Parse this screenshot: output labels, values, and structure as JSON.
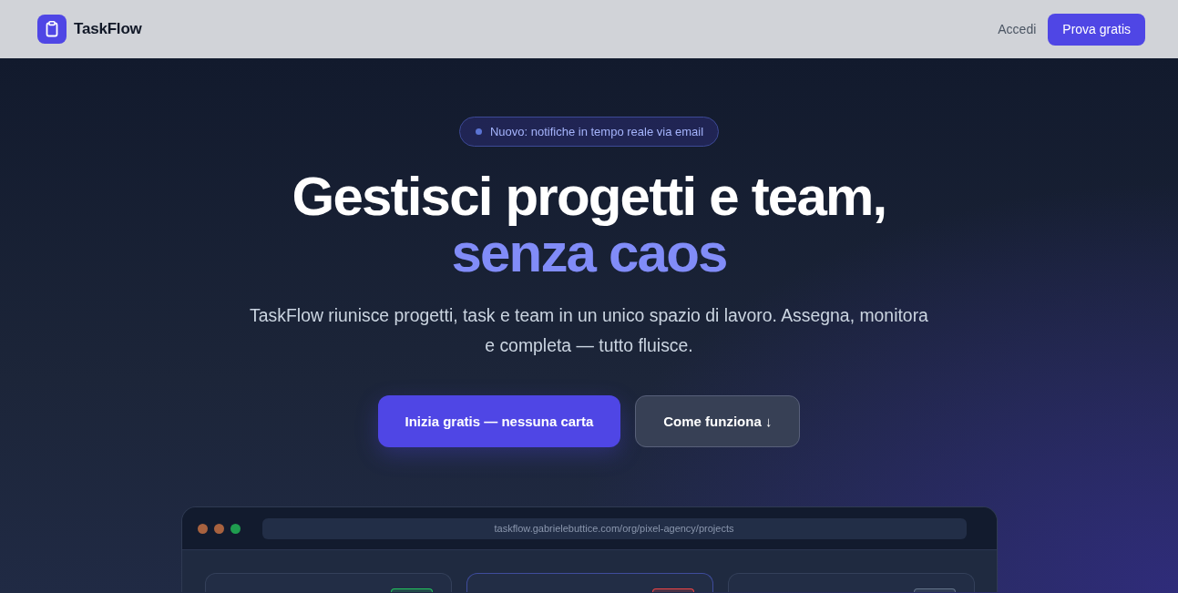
{
  "header": {
    "brand": "TaskFlow",
    "links": [
      {
        "label": "Accedi",
        "kind": "link"
      },
      {
        "label": "Prova gratis",
        "kind": "button"
      }
    ]
  },
  "hero": {
    "badge": "Nuovo: notifiche in tempo reale via email",
    "title": "Gestisci progetti e team,",
    "highlight": "senza caos",
    "description": "TaskFlow riunisce progetti, task e team in un unico spazio di lavoro. Assegna, monitora e completa — tutto fluisce.",
    "actions": [
      {
        "label": "Inizia gratis — nessuna carta",
        "kind": "primary"
      },
      {
        "label": "Come funziona ↓",
        "kind": "secondary"
      }
    ]
  },
  "preview": {
    "window_dots": [
      {
        "color": "#a8623f"
      },
      {
        "color": "#a8623f"
      },
      {
        "color": "#1f9d4f"
      }
    ],
    "address": "taskflow.gabrielebuttice.com/org/pixel-agency/projects",
    "cards": [
      {
        "selected": false,
        "color": "#22c55e"
      },
      {
        "selected": true,
        "color": "#ef4444"
      },
      {
        "selected": false,
        "color": "#64748b"
      }
    ]
  }
}
